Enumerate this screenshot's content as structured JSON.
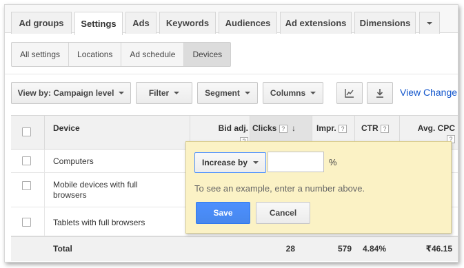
{
  "tabs": [
    {
      "label": "Ad groups"
    },
    {
      "label": "Settings",
      "active": true
    },
    {
      "label": "Ads"
    },
    {
      "label": "Keywords"
    },
    {
      "label": "Audiences"
    },
    {
      "label": "Ad extensions"
    },
    {
      "label": "Dimensions"
    }
  ],
  "subtabs": [
    {
      "label": "All settings"
    },
    {
      "label": "Locations"
    },
    {
      "label": "Ad schedule"
    },
    {
      "label": "Devices",
      "active": true
    }
  ],
  "toolbar": {
    "view_by_label": "View by: Campaign level",
    "filter_label": "Filter",
    "segment_label": "Segment",
    "columns_label": "Columns",
    "chart_icon": "line-chart-icon",
    "download_icon": "download-icon",
    "view_change_label": "View Change"
  },
  "table": {
    "headers": {
      "device": "Device",
      "bid_adj": "Bid adj.",
      "clicks": "Clicks",
      "impr": "Impr.",
      "ctr": "CTR",
      "avg_cpc": "Avg. CPC",
      "help": "?"
    },
    "rows": [
      {
        "device": "Computers"
      },
      {
        "device": "Mobile devices with full browsers"
      },
      {
        "device": "Tablets with full browsers"
      }
    ],
    "total": {
      "label": "Total",
      "clicks": "28",
      "impr": "579",
      "ctr": "4.84%",
      "avg_cpc": "₹46.15"
    }
  },
  "popup": {
    "mode_label": "Increase by",
    "value": "",
    "unit": "%",
    "hint": "To see an example, enter a number above.",
    "save_label": "Save",
    "cancel_label": "Cancel"
  },
  "colors": {
    "accent": "#4d90fe",
    "link": "#1155cc",
    "popup_bg": "#fbf2c5"
  }
}
